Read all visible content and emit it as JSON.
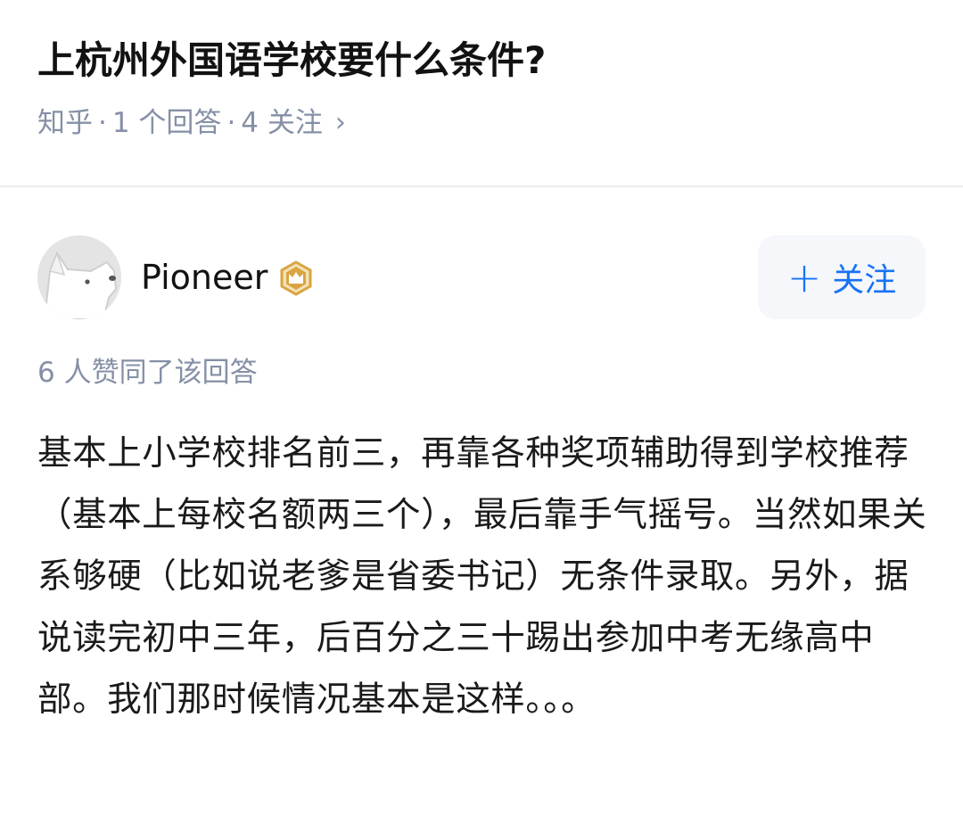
{
  "question": {
    "title": "上杭州外国语学校要什么条件?",
    "source": "知乎",
    "separator": "·",
    "answers": "1 个回答",
    "followers": "4 关注",
    "chevron": "›"
  },
  "author": {
    "name": "Pioneer",
    "avatar_icon": "cartoon-dog-avatar",
    "badge_icon": "gold-crown-badge-icon",
    "badge_color": "#d9a441"
  },
  "follow": {
    "icon": "+",
    "label": "关注",
    "color": "#1772f6"
  },
  "answer": {
    "agree_text": "6 人赞同了该回答",
    "content": "基本上小学校排名前三，再靠各种奖项辅助得到学校推荐（基本上每校名额两三个），最后靠手气摇号。当然如果关系够硬（比如说老爹是省委书记）无条件录取。另外，据说读完初中三年，后百分之三十踢出参加中考无缘高中部。我们那时候情况基本是这样。。。"
  }
}
